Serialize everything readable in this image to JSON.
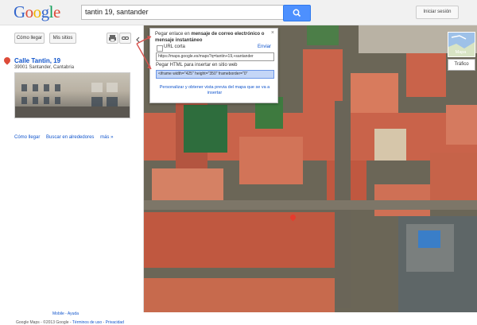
{
  "header": {
    "logo_letters": [
      {
        "ch": "G",
        "color": "#3366cc"
      },
      {
        "ch": "o",
        "color": "#dd4b39"
      },
      {
        "ch": "o",
        "color": "#f2b400"
      },
      {
        "ch": "g",
        "color": "#3366cc"
      },
      {
        "ch": "l",
        "color": "#0f9d58"
      },
      {
        "ch": "e",
        "color": "#dd4b39"
      }
    ],
    "search_value": "tantin 19, santander",
    "search_icon": "search-icon",
    "signin_label": "Iniciar sesión"
  },
  "panel": {
    "how_to_get_label": "Cómo llegar",
    "my_sites_label": "Mis sitios",
    "print_icon": "printer-icon",
    "link_icon": "link-icon",
    "collapse_icon": "chevron-left-icon",
    "place": {
      "title": "Calle Tantin, 19",
      "address": "39001 Santander, Cantabria"
    },
    "links": {
      "directions": "Cómo llegar",
      "nearby": "Buscar en alrededores",
      "more": "más »"
    },
    "footer": {
      "line1": "Mobile - Ayuda",
      "line2_prefix": "Google Maps - ©2013 Google -",
      "terms": "Términos de uso",
      "privacy": "Privacidad"
    }
  },
  "popup": {
    "intro_prefix": "Pegar enlace en",
    "intro_bold": "mensaje de correo electrónico o mensaje instantáneo",
    "short_url_label": "URL corta",
    "send_label": "Enviar",
    "url_value": "https://maps.google.es/maps?q=tantin+19,+santander",
    "html_label": "Pegar HTML para insertar en sitio web",
    "html_value": "<iframe width=\"425\" height=\"350\" frameborder=\"0\"",
    "customize_text": "Personalizar y obtener vista previa del mapa que se va a insertar",
    "close_symbol": "×"
  },
  "map_controls": {
    "map_label": "Mapa",
    "traffic_label": "Tráfico"
  },
  "colors": {
    "accent": "#4d90fe",
    "link": "#1155cc",
    "marker": "#dd4b39",
    "arrow": "#d9534f"
  }
}
